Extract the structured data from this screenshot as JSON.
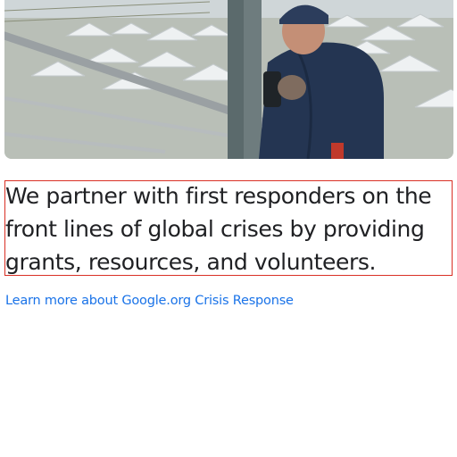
{
  "hero": {
    "image_subject": "Aid worker in a navy jacket and knit cap holding a radio beside a metal railing above a field of white tents"
  },
  "statement": {
    "text": "We partner with first responders on the front lines of global crises by providing grants, resources, and volunteers."
  },
  "links": {
    "learn_more_label": "Learn more about Google.org Crisis Response"
  },
  "colors": {
    "text": "#202124",
    "link": "#1a73e8",
    "highlight_border": "#d93025"
  }
}
